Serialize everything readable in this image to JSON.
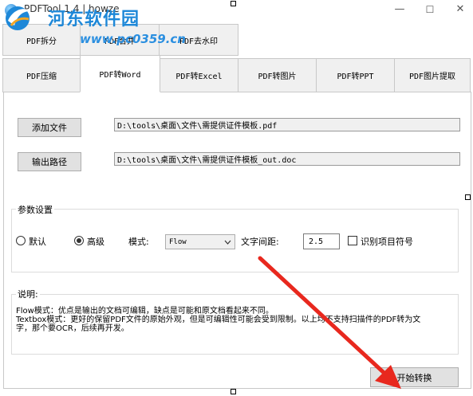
{
  "window": {
    "title": "PDFTool 1.4 | howze",
    "minimize_glyph": "—",
    "maximize_glyph": "☐",
    "close_glyph": "✕"
  },
  "watermark": {
    "name": "河东软件园",
    "url": "www.pc0359.cn"
  },
  "tabs_row1": [
    {
      "label": "PDF拆分"
    },
    {
      "label": "PDF合并"
    },
    {
      "label": "PDF去水印"
    }
  ],
  "tabs_row2": [
    {
      "label": "PDF压缩"
    },
    {
      "label": "PDF转Word",
      "active": true
    },
    {
      "label": "PDF转Excel"
    },
    {
      "label": "PDF转图片"
    },
    {
      "label": "PDF转PPT"
    },
    {
      "label": "PDF图片提取"
    }
  ],
  "files": {
    "add_button": "添加文件",
    "input_path": "D:\\tools\\桌面\\文件\\需提供证件模板.pdf",
    "output_button": "输出路径",
    "output_path": "D:\\tools\\桌面\\文件\\需提供证件模板_out.doc"
  },
  "params": {
    "group_title": "参数设置",
    "default_label": "默认",
    "advanced_label": "高级",
    "mode_label": "模式:",
    "mode_value": "Flow",
    "spacing_label": "文字间距:",
    "spacing_value": "2.5",
    "recognize_label": "识别项目符号",
    "selected_mode": "高级"
  },
  "description": {
    "group_title": "说明:",
    "text": "Flow模式：优点是输出的文档可编辑，缺点是可能和原文档看起来不同。\nTextbox模式：更好的保留PDF文件的原始外观，但是可编辑性可能会受到限制。以上均不支持扫描件的PDF转为文\n字，那个要OCR，后续再开发。"
  },
  "start_button": "开始转换",
  "colors": {
    "arrow": "#e8281e",
    "watermark": "#1e88d8"
  }
}
